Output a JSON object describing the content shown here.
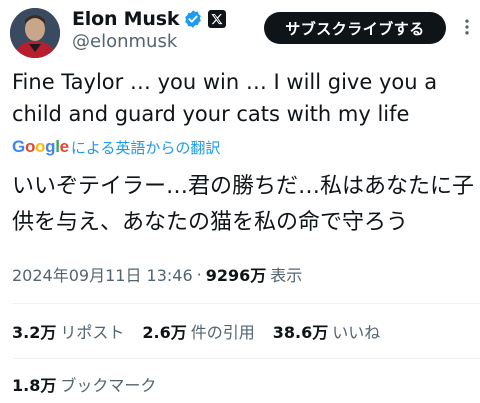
{
  "author": {
    "name": "Elon Musk",
    "handle": "@elonmusk",
    "verified_icon": "verified-badge-icon",
    "affiliation_icon": "x-logo-icon"
  },
  "header": {
    "subscribe_label": "サブスクライブする",
    "more_icon": "more-options-icon"
  },
  "tweet": {
    "text": "Fine Taylor … you win … I will give you a child and guard your cats with my life"
  },
  "translation": {
    "provider_logo": [
      "G",
      "o",
      "o",
      "g",
      "l",
      "e"
    ],
    "label": "による英語からの翻訳",
    "text": "いいぞテイラー…君の勝ちだ…私はあなたに子供を与え、あなたの猫を私の命で守ろう"
  },
  "meta": {
    "timestamp": "2024年09月11日 13:46",
    "separator": "·",
    "views": "9296万",
    "views_label": "表示"
  },
  "stats": [
    {
      "count": "3.2万",
      "label": "リポスト"
    },
    {
      "count": "2.6万",
      "label": "件の引用"
    },
    {
      "count": "38.6万",
      "label": "いいね"
    }
  ],
  "bookmarks": {
    "count": "1.8万",
    "label": "ブックマーク"
  },
  "colors": {
    "text": "#0f1419",
    "secondary": "#536471",
    "accent": "#1d9bf0",
    "google_blue": "#4285f4",
    "google_red": "#ea4335",
    "google_yellow": "#fbbc05",
    "google_green": "#34a853"
  }
}
